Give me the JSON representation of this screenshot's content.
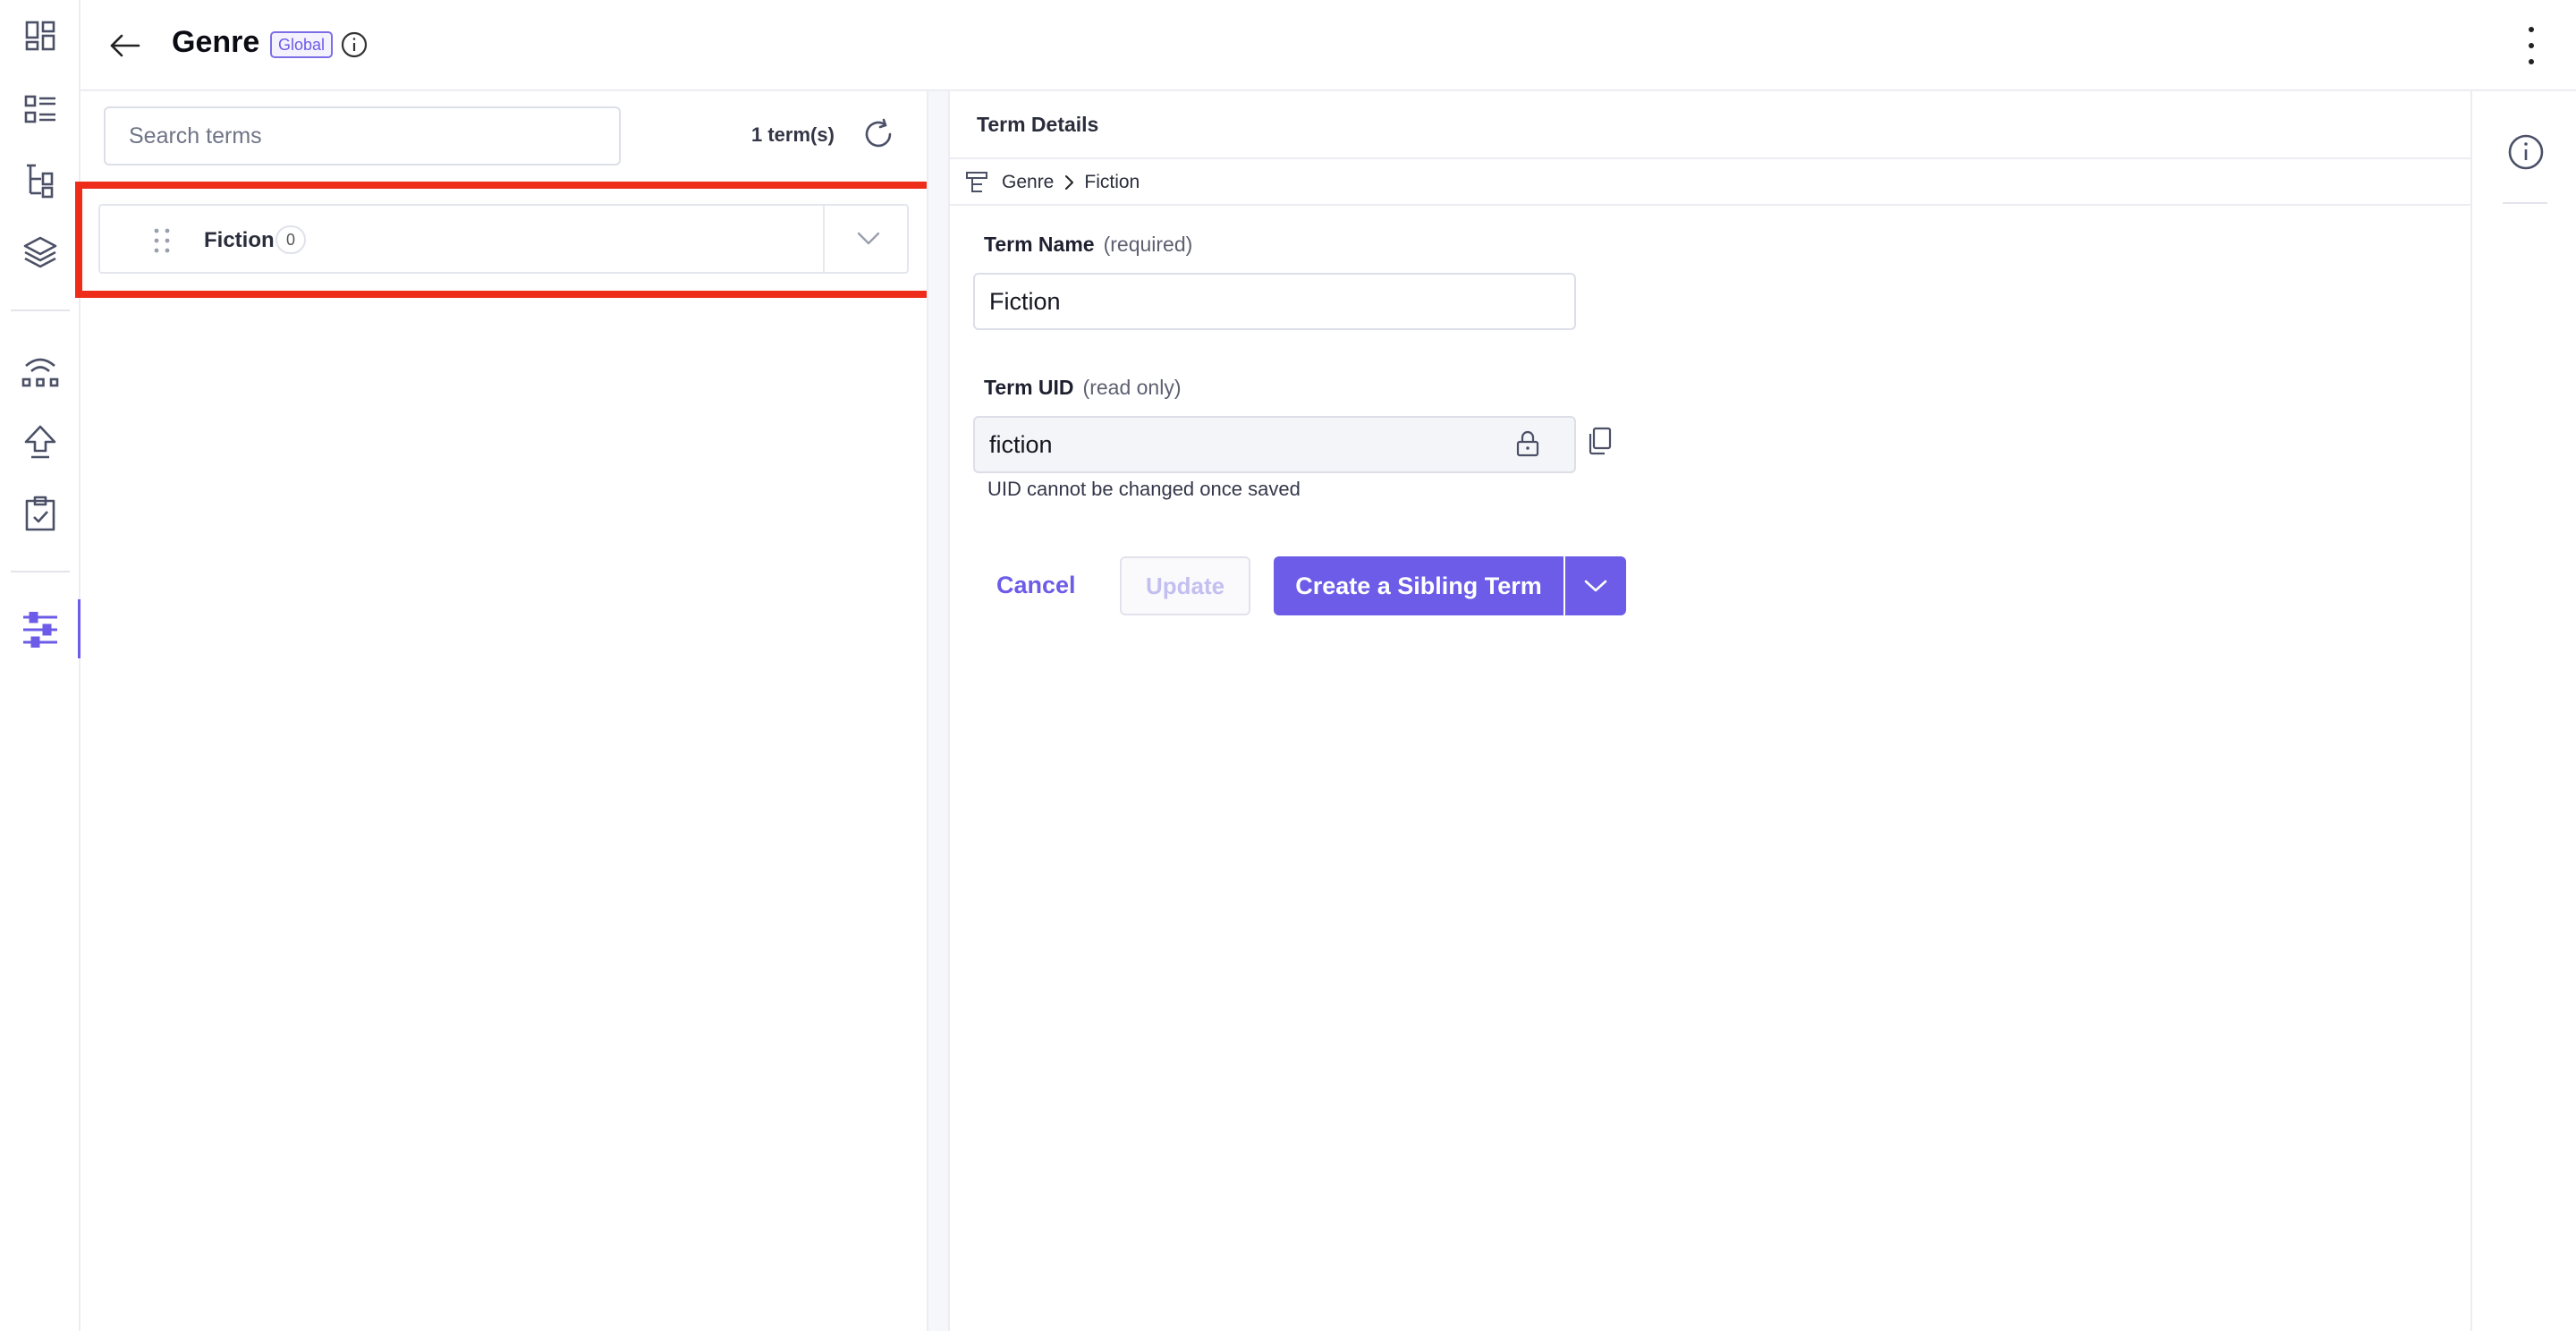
{
  "header": {
    "back_icon": "arrow-left-icon",
    "title": "Genre",
    "badge": "Global",
    "info_icon": "info-circle-icon",
    "more_icon": "more-vertical-icon"
  },
  "rail": {
    "items": [
      {
        "icon": "dashboard-icon"
      },
      {
        "icon": "entries-list-icon"
      },
      {
        "icon": "content-models-icon"
      },
      {
        "icon": "stack-layers-icon"
      },
      {
        "icon": "network-icon"
      },
      {
        "icon": "deploy-upload-icon"
      },
      {
        "icon": "tasks-clipboard-icon"
      },
      {
        "icon": "settings-sliders-icon",
        "active": true
      }
    ],
    "accent": "#6c5ce7"
  },
  "terms_panel": {
    "search_placeholder": "Search terms",
    "count": "1 term(s)",
    "refresh_icon": "refresh-icon",
    "terms": [
      {
        "name": "Fiction",
        "children": "0"
      }
    ],
    "highlight_color": "#ee2c1a"
  },
  "details": {
    "title": "Term Details",
    "breadcrumb": [
      "Genre",
      "Fiction"
    ],
    "term_name": {
      "label": "Term Name",
      "hint": "(required)",
      "value": "Fiction"
    },
    "term_uid": {
      "label": "Term UID",
      "hint": "(read only)",
      "value": "fiction",
      "help": "UID cannot be changed once saved"
    },
    "buttons": {
      "cancel": "Cancel",
      "update": "Update",
      "create_sibling": "Create a Sibling Term"
    }
  },
  "colors": {
    "primary": "#6c5ce7",
    "border": "#dcdfe7"
  }
}
